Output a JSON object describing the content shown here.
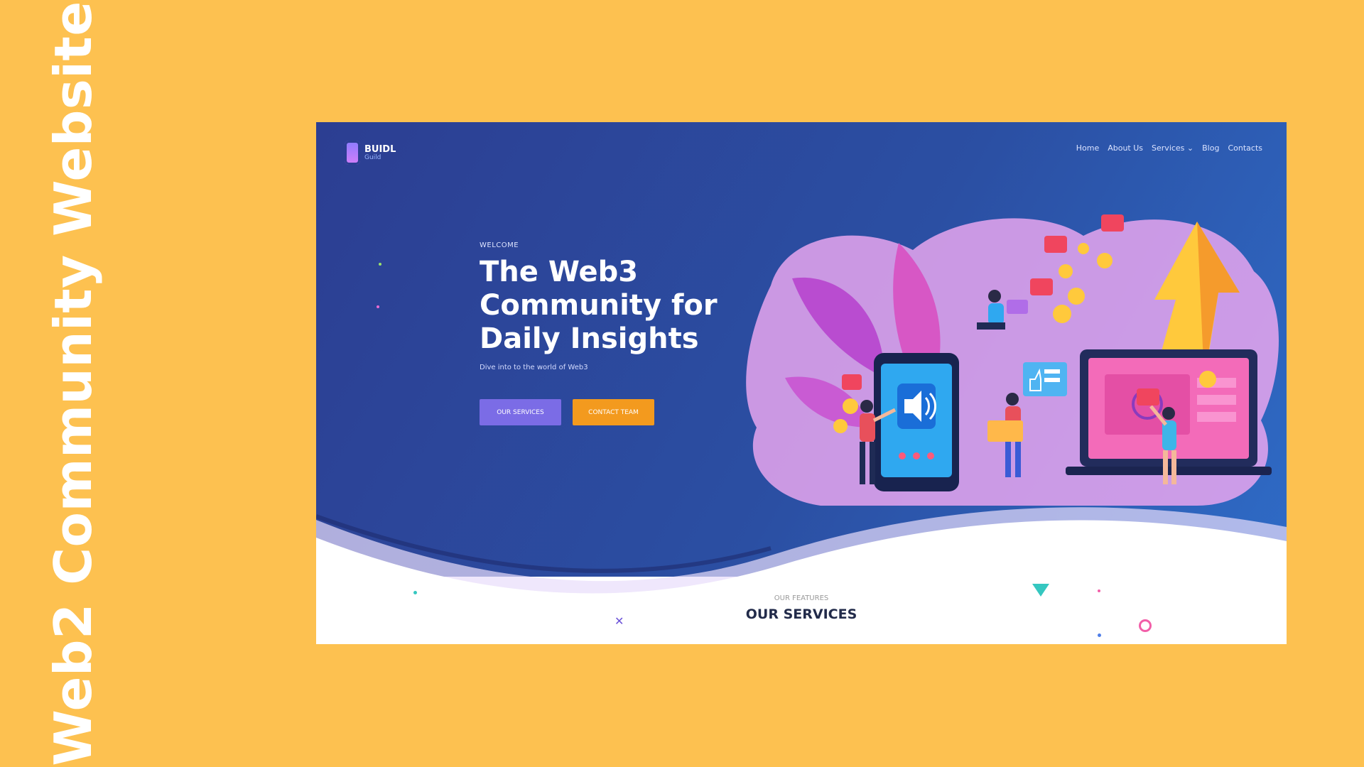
{
  "page": {
    "side_title": "Web2 Community Website"
  },
  "site": {
    "logo_text": "BUIDL",
    "logo_sub": "Guild",
    "nav": [
      "Home",
      "About Us",
      "Services ⌄",
      "Blog",
      "Contacts"
    ],
    "hero": {
      "kicker": "WELCOME",
      "headline": "The Web3 Community for Daily Insights",
      "subhead": "Dive into to the world of Web3",
      "primary_button": "OUR SERVICES",
      "secondary_button": "CONTACT TEAM"
    },
    "services": {
      "kicker": "OUR FEATURES",
      "title": "OUR SERVICES"
    }
  },
  "colors": {
    "page_bg": "#FDC150",
    "hero_bg": "#2C3E92",
    "primary_button": "#7B6CE6",
    "secondary_button": "#F39A1E",
    "accent_pink": "#E65FB4",
    "accent_yellow": "#FFC93C"
  },
  "icons": [
    "logo-icon",
    "speaker-icon",
    "like-bubble-icon",
    "dollar-coin-icon",
    "thumbs-up-icon",
    "arrow-up-icon"
  ]
}
